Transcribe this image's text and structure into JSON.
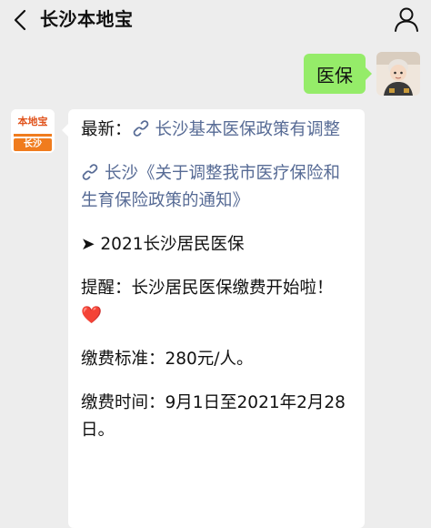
{
  "header": {
    "title": "长沙本地宝"
  },
  "icons": {
    "back": "chevron-left-icon",
    "profile": "person-icon",
    "link": "mini-program-link-icon",
    "arrow": "arrow-right-bullet-icon",
    "heart": "heart-emoji-icon"
  },
  "colors": {
    "background": "#ededed",
    "sent_bubble": "#95ec69",
    "received_bubble": "#ffffff",
    "link": "#576b95",
    "brand_orange": "#f07c1e"
  },
  "messages": {
    "sent": {
      "text": "医保"
    },
    "received": {
      "avatar_logo": "本地宝",
      "avatar_city": "长沙",
      "latest_label": "最新：",
      "latest_link": "长沙基本医保政策有调整",
      "article_link": "长沙《关于调整我市医疗保险和生育保险政策的通知》",
      "section_bullet": "➤",
      "section_title": "2021长沙居民医保",
      "reminder": "提醒：长沙居民医保缴费开始啦！",
      "heart": "❤️",
      "fee_standard": "缴费标准：280元/人。",
      "fee_time": "缴费时间：9月1日至2021年2月28日。"
    }
  }
}
